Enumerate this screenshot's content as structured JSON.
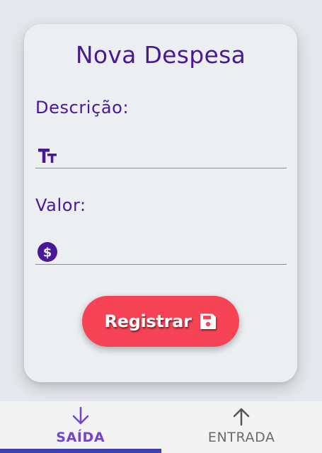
{
  "form": {
    "title": "Nova Despesa",
    "description_label": "Descrição:",
    "description_value": "",
    "value_label": "Valor:",
    "value_value": "",
    "submit_label": "Registrar"
  },
  "nav": {
    "tabs": [
      {
        "label": "SAÍDA",
        "icon": "arrow-down-icon",
        "active": true
      },
      {
        "label": "ENTRADA",
        "icon": "arrow-up-icon",
        "active": false
      }
    ]
  },
  "colors": {
    "primary": "#4a1797",
    "accent": "#f64355",
    "active_tab": "#7542d4",
    "indicator": "#3f3fad"
  }
}
